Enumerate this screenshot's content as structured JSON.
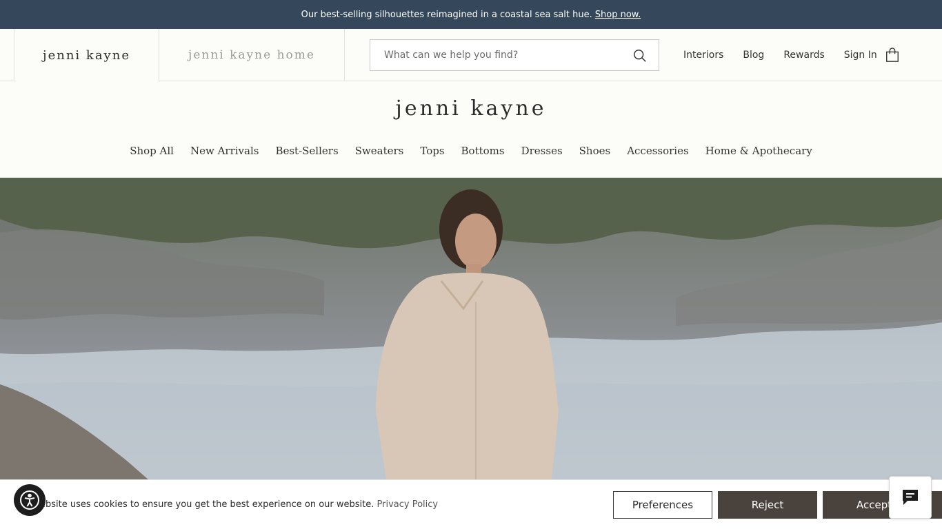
{
  "announcement": {
    "text": "Our best-selling silhouettes reimagined in a coastal sea salt hue.",
    "link": "Shop now."
  },
  "header": {
    "brand_tabs": [
      "jenni kayne",
      "jenni kayne home"
    ],
    "search": {
      "placeholder": "What can we help you find?",
      "value": ""
    },
    "utility_links": [
      "Interiors",
      "Blog",
      "Rewards",
      "Sign In"
    ],
    "logo": "jenni kayne"
  },
  "main_nav": [
    "Shop All",
    "New Arrivals",
    "Best-Sellers",
    "Sweaters",
    "Tops",
    "Bottoms",
    "Dresses",
    "Shoes",
    "Accessories",
    "Home & Apothecary"
  ],
  "cookie_banner": {
    "text": "ebsite uses cookies to ensure you get the best experience on our website.",
    "policy_link": "Privacy Policy",
    "preferences": "Preferences",
    "reject": "Reject",
    "accept": "Accept"
  },
  "icons": {
    "search": "search-icon",
    "bag": "shopping-bag-icon",
    "accessibility": "accessibility-icon",
    "chat": "chat-icon"
  },
  "colors": {
    "announcement_bg": "#34475b",
    "button_dark": "#4a433d",
    "page_bg": "#fcfcf8"
  }
}
